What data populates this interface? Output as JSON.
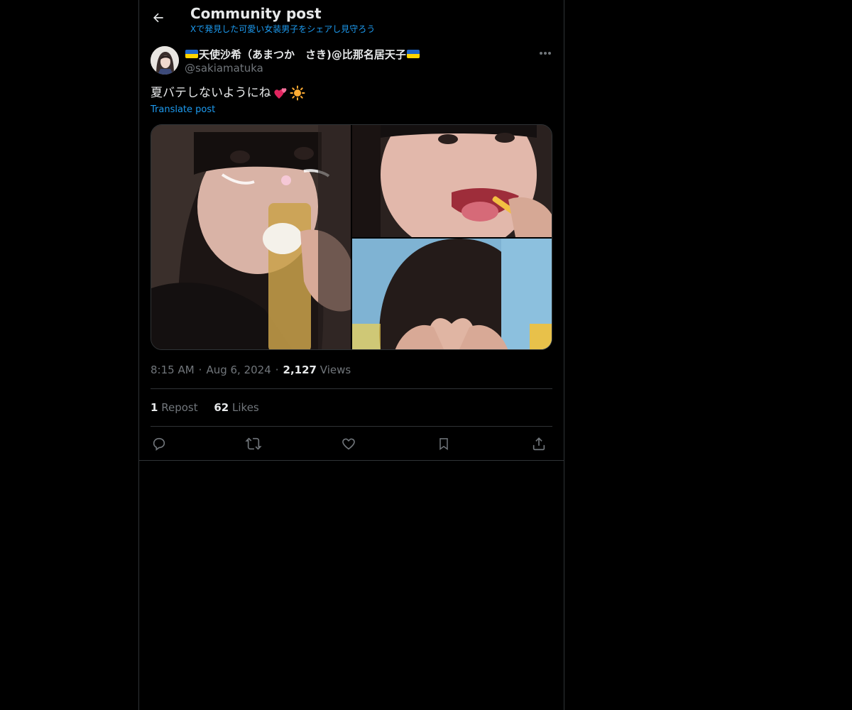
{
  "header": {
    "title": "Community post",
    "subtitle": "Xで発見した可愛い女装男子をシェアし見守ろう",
    "back_icon": "arrow-left-icon"
  },
  "post": {
    "author": {
      "display_name": "天使沙希（あまつか　さき)@比那名居天子",
      "handle": "@sakiamatuka",
      "flag_icon": "ukraine-flag-icon"
    },
    "text": "夏バテしないようにね",
    "emojis": [
      "two-hearts-emoji",
      "sun-emoji"
    ],
    "translate_label": "Translate post",
    "media": [
      {
        "name": "photo-1",
        "description": "selfie-with-beer-glass"
      },
      {
        "name": "photo-2",
        "description": "selfie-eating-fry"
      },
      {
        "name": "photo-3",
        "description": "selfie-heart-hands"
      }
    ],
    "time": "8:15 AM",
    "date": "Aug 6, 2024",
    "views_count": "2,127",
    "views_label": "Views",
    "reposts_count": "1",
    "reposts_label": "Repost",
    "likes_count": "62",
    "likes_label": "Likes"
  },
  "actions": [
    {
      "name": "reply",
      "icon": "reply-icon"
    },
    {
      "name": "repost",
      "icon": "repost-icon"
    },
    {
      "name": "like",
      "icon": "heart-icon"
    },
    {
      "name": "bookmark",
      "icon": "bookmark-icon"
    },
    {
      "name": "share",
      "icon": "share-icon"
    }
  ],
  "colors": {
    "background": "#000000",
    "text": "#e7e9ea",
    "secondary": "#71767b",
    "accent": "#1d9bf0",
    "border": "#2f3336"
  }
}
